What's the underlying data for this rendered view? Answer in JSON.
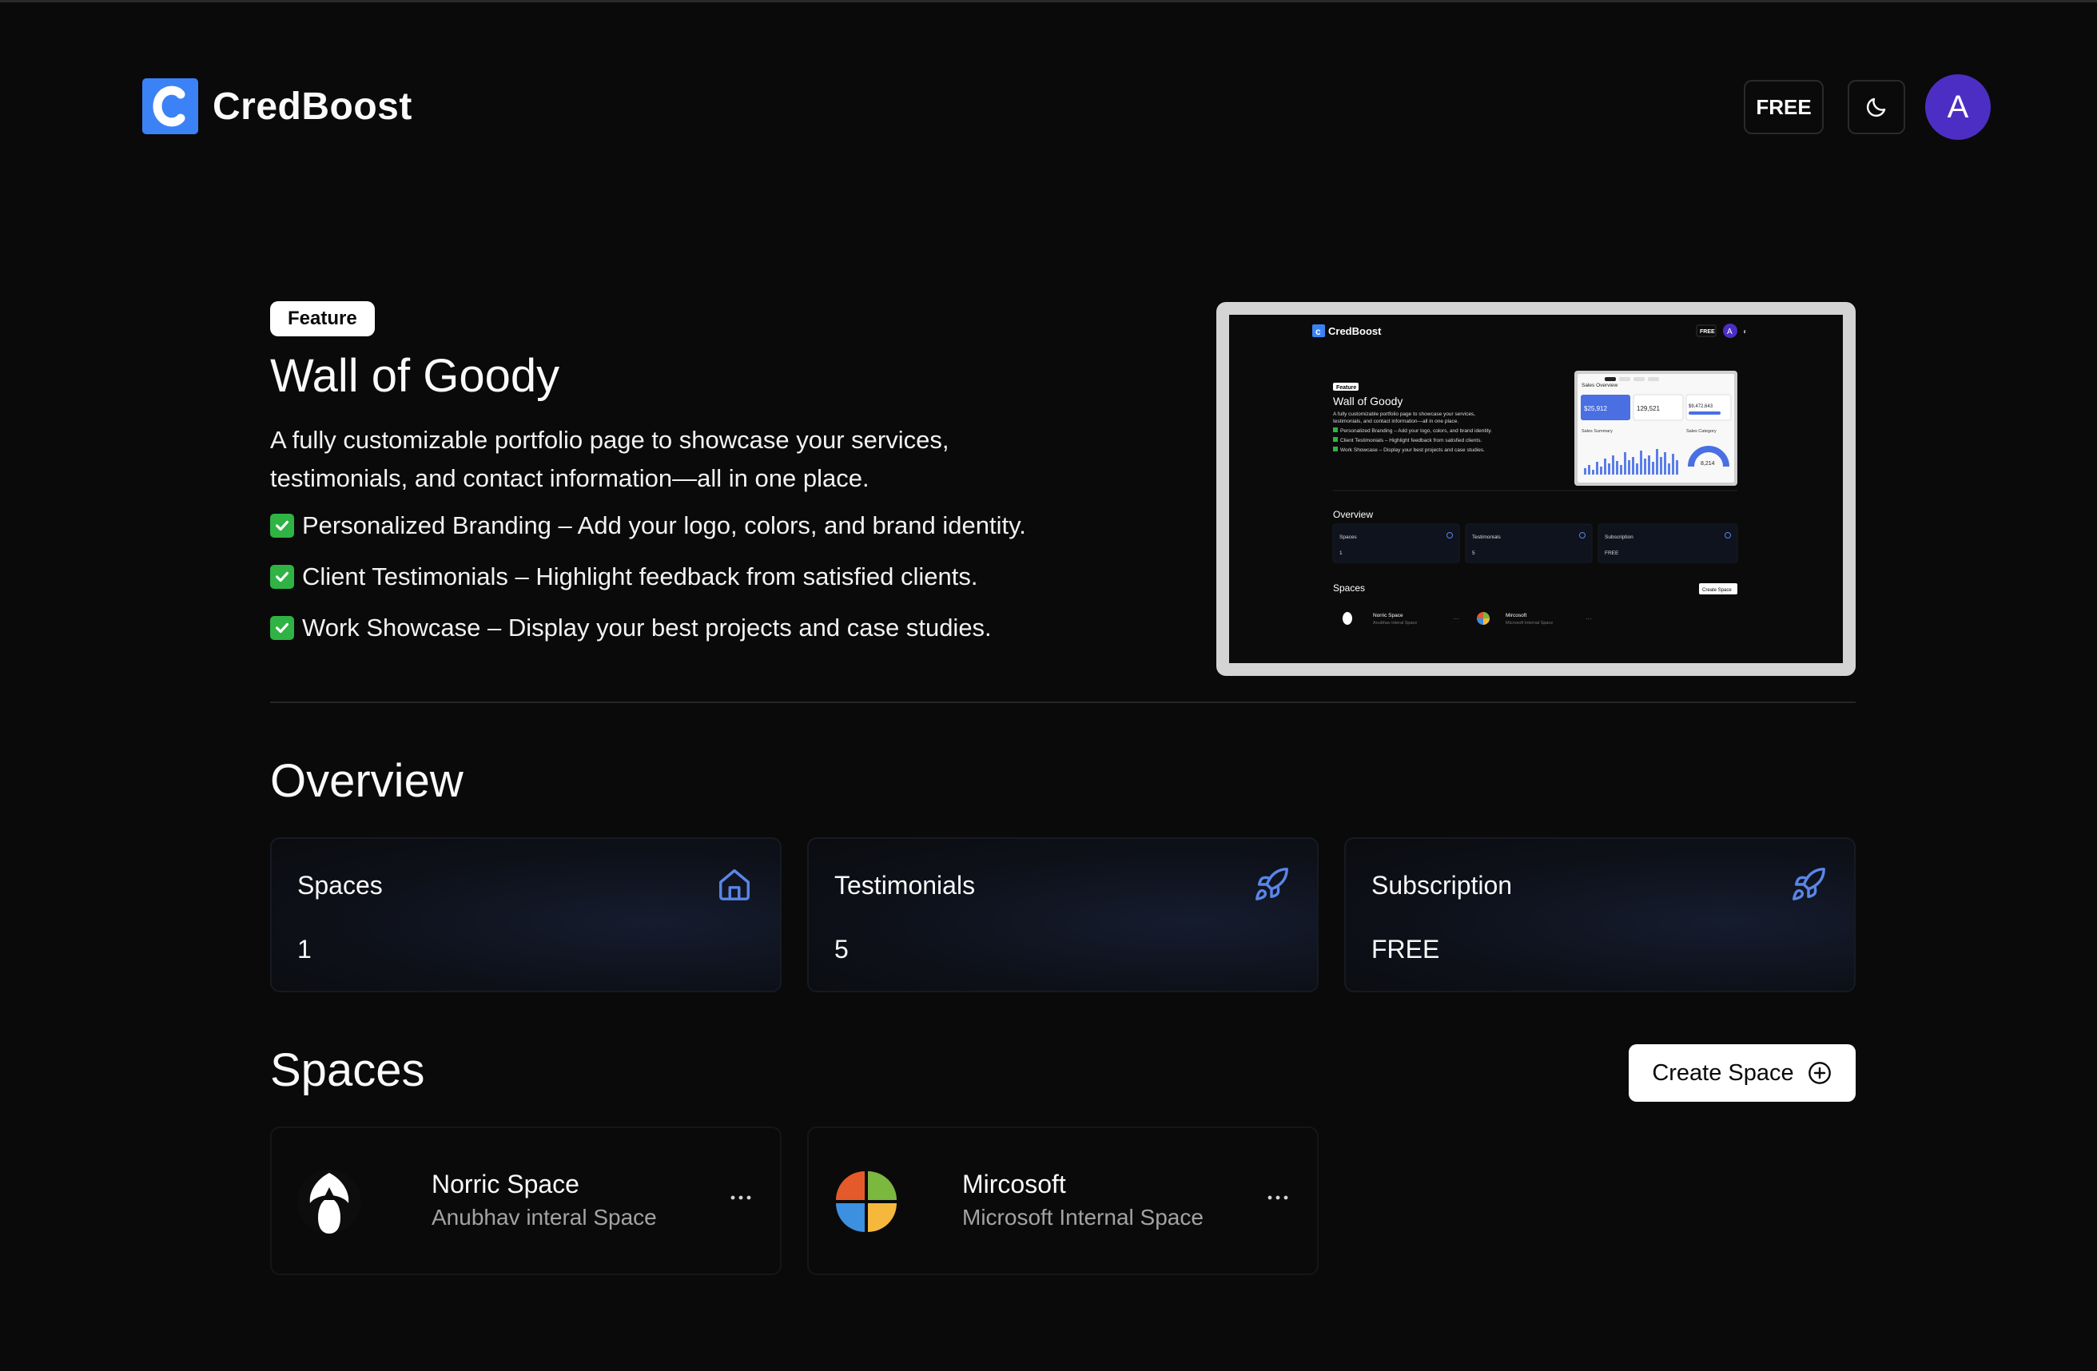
{
  "app": {
    "name": "CredBoost"
  },
  "header": {
    "plan_label": "FREE",
    "avatar_initial": "A"
  },
  "feature": {
    "badge": "Feature",
    "title": "Wall of Goody",
    "description": "A fully customizable portfolio page to showcase your services, testimonials, and contact information—all in one place.",
    "bullets": [
      "Personalized Branding – Add your logo, colors, and brand identity.",
      "Client Testimonials – Highlight feedback from satisfied clients.",
      "Work Showcase – Display your best projects and case studies."
    ]
  },
  "overview": {
    "title": "Overview",
    "cards": [
      {
        "label": "Spaces",
        "value": "1",
        "icon": "home-icon"
      },
      {
        "label": "Testimonials",
        "value": "5",
        "icon": "rocket-icon"
      },
      {
        "label": "Subscription",
        "value": "FREE",
        "icon": "rocket-icon"
      }
    ]
  },
  "spaces": {
    "title": "Spaces",
    "create_label": "Create Space",
    "items": [
      {
        "name": "Norric Space",
        "subtitle": "Anubhav interal Space",
        "logo": "norric-logo"
      },
      {
        "name": "Mircosoft",
        "subtitle": "Microsoft Internal Space",
        "logo": "microsoft-logo"
      }
    ]
  },
  "preview": {
    "app_name": "CredBoost",
    "plan": "FREE",
    "avatar": "A",
    "badge": "Feature",
    "title": "Wall of Goody",
    "desc_line1": "A fully customizable portfolio page to showcase your services,",
    "desc_line2": "testimonials, and contact information—all in one place.",
    "bullet1": "Personalized Branding – Add your logo, colors, and brand identity.",
    "bullet2": "Client Testimonials – Highlight feedback from satisfied clients.",
    "bullet3": "Work Showcase – Display your best projects and case studies.",
    "overview_title": "Overview",
    "card1_label": "Spaces",
    "card1_value": "1",
    "card2_label": "Testimonials",
    "card2_value": "5",
    "card3_label": "Subscription",
    "card3_value": "FREE",
    "spaces_title": "Spaces",
    "create_label": "Create Space",
    "space1_name": "Norric Space",
    "space1_sub": "Anubhav interal Space",
    "space2_name": "Mircosoft",
    "space2_sub": "Microsoft Internal Space",
    "dashboard": {
      "title": "Sales Overview",
      "stat1": "$25,912",
      "stat2": "129,521",
      "stat3": "$9,472,643",
      "summary_label": "Sales Summary",
      "category_label": "Sales Category",
      "gauge_value": "8,214"
    }
  },
  "colors": {
    "accent": "#3b82f6",
    "avatar": "#4c2ec4",
    "check": "#2fb344",
    "background": "#0a0a0a"
  }
}
